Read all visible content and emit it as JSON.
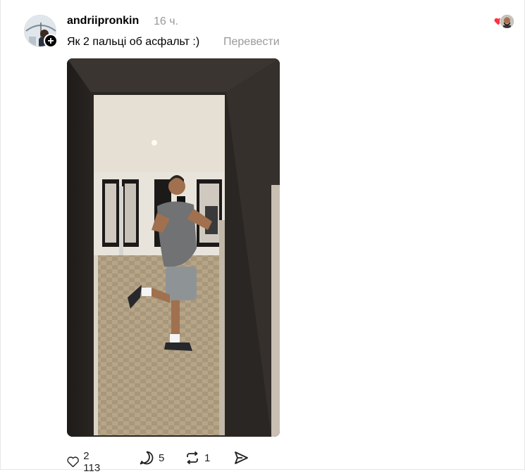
{
  "post": {
    "username": "andriipronkin",
    "time": "16 ч.",
    "caption": "Як 2 пальці об асфальт :)",
    "translate_label": "Перевести",
    "image_alt": "Фото"
  },
  "actions": {
    "likes": "2 113",
    "replies": "5",
    "reposts": "1"
  },
  "colors": {
    "accent_heart": "#ff3040",
    "muted_text": "#999999"
  }
}
